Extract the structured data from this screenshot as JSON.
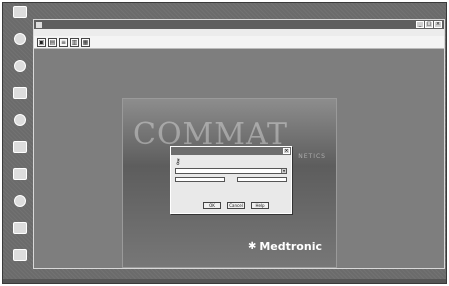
{
  "desktop": {
    "icons": [
      {
        "icon": "my-computer-icon",
        "label": ""
      },
      {
        "icon": "network-icon",
        "label": ""
      },
      {
        "icon": "internet-icon",
        "label": ""
      },
      {
        "icon": "program-icon",
        "label": ""
      },
      {
        "icon": "shortcut-icon",
        "label": ""
      },
      {
        "icon": "document-icon",
        "label": ""
      },
      {
        "icon": "folder-icon",
        "label": ""
      },
      {
        "icon": "tool-icon",
        "label": ""
      },
      {
        "icon": "application-icon",
        "label": ""
      },
      {
        "icon": "recycle-bin-icon",
        "label": ""
      }
    ]
  },
  "window": {
    "title": "",
    "buttons": {
      "minimize": "_",
      "maximize": "□",
      "close": "×"
    },
    "menu": [
      "",
      "",
      "",
      "",
      ""
    ],
    "toolbar": [
      {
        "icon": "open-icon",
        "glyph": "▣"
      },
      {
        "icon": "save-icon",
        "glyph": "▤"
      },
      {
        "icon": "list-icon",
        "glyph": "≡"
      },
      {
        "icon": "report-icon",
        "glyph": "▥"
      },
      {
        "icon": "book-icon",
        "glyph": "▦"
      }
    ]
  },
  "splash": {
    "watermark": "COMMAT",
    "subtitle": "NETICS",
    "brand": "Medtronic",
    "brand_mark": "✱"
  },
  "login_dialog": {
    "title": "",
    "message": "",
    "database_label": "",
    "database_value": "",
    "userid_label": "",
    "password_label": "",
    "ok_label": "OK",
    "cancel_label": "Cancel",
    "help_label": "Help"
  }
}
